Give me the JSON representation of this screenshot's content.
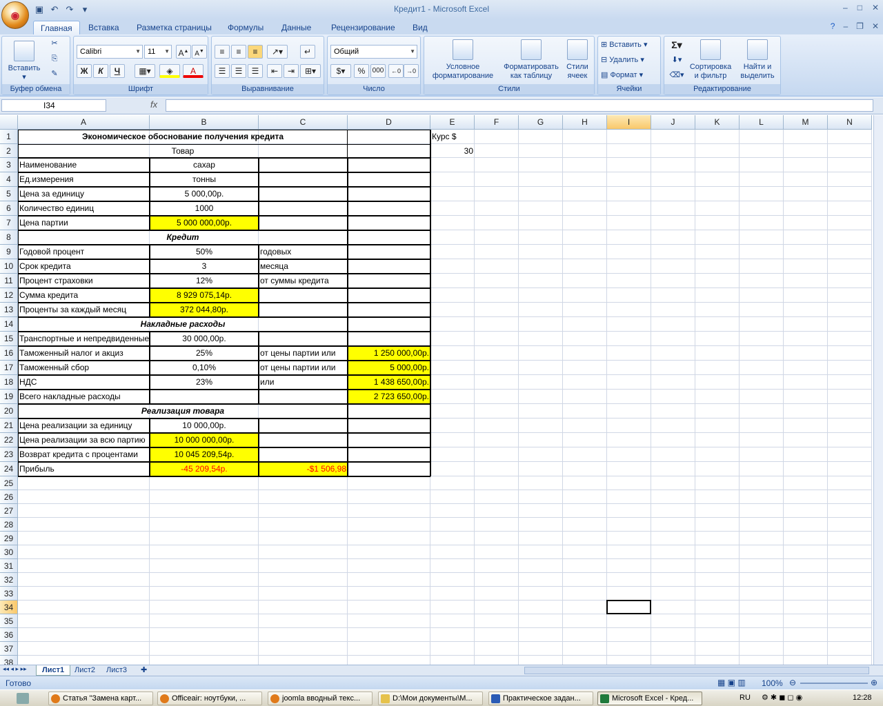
{
  "window": {
    "title": "Кредит1 - Microsoft Excel"
  },
  "ribbon_tabs": [
    "Главная",
    "Вставка",
    "Разметка страницы",
    "Формулы",
    "Данные",
    "Рецензирование",
    "Вид"
  ],
  "ribbon": {
    "paste": "Вставить",
    "font_name": "Calibri",
    "font_size": "11",
    "number_format": "Общий",
    "cond_fmt": "Условное форматирование",
    "fmt_table": "Форматировать как таблицу",
    "cell_styles": "Стили ячеек",
    "insert": "Вставить",
    "delete": "Удалить",
    "format": "Формат",
    "sort_filter": "Сортировка и фильтр",
    "find_select": "Найти и выделить",
    "bold": "Ж",
    "italic": "К",
    "underline": "Ч",
    "percent": "%",
    "thousands": "000",
    "groups": {
      "clipboard": "Буфер обмена",
      "font": "Шрифт",
      "align": "Выравнивание",
      "number": "Число",
      "styles": "Стили",
      "cells": "Ячейки",
      "editing": "Редактирование"
    }
  },
  "formula_bar": {
    "name_box": "I34",
    "fx": "fx",
    "content": ""
  },
  "columns": [
    "A",
    "B",
    "C",
    "D",
    "E",
    "F",
    "G",
    "H",
    "I",
    "J",
    "K",
    "L",
    "M",
    "N"
  ],
  "rows": [
    "1",
    "2",
    "3",
    "4",
    "5",
    "6",
    "7",
    "8",
    "9",
    "10",
    "11",
    "12",
    "13",
    "14",
    "15",
    "16",
    "17",
    "18",
    "19",
    "20",
    "21",
    "22",
    "23",
    "24",
    "25",
    "26",
    "27",
    "28",
    "29",
    "30",
    "31",
    "32",
    "33",
    "34",
    "35",
    "36",
    "37",
    "38"
  ],
  "cells": {
    "A1": "Экономическое обоснование получения кредита",
    "E1": "Курс $",
    "B2": "Товар",
    "E2": "30",
    "A3": "Наименование",
    "B3": "сахар",
    "A4": "Ед.измерения",
    "B4": "тонны",
    "A5": "Цена за единицу",
    "B5": "5 000,00р.",
    "A6": "Количество единиц",
    "B6": "1000",
    "A7": "Цена партии",
    "B7": "5 000 000,00р.",
    "B8": "Кредит",
    "A9": "Годовой процент",
    "B9": "50%",
    "C9": "годовых",
    "A10": "Срок кредита",
    "B10": "3",
    "C10": "месяца",
    "A11": "Процент страховки",
    "B11": "12%",
    "C11": "от суммы кредита",
    "A12": "Сумма кредита",
    "B12": "8 929 075,14р.",
    "A13": "Проценты за каждый месяц",
    "B13": "372 044,80р.",
    "B14": "Накладные расходы",
    "A15": "Транспортные и непредвиденные",
    "B15": "30 000,00р.",
    "A16": "Таможенный налог и акциз",
    "B16": "25%",
    "C16": "от цены партии или",
    "D16": "1 250 000,00р.",
    "A17": "Таможенный сбор",
    "B17": "0,10%",
    "C17": "от цены партии или",
    "D17": "5 000,00р.",
    "A18": "НДС",
    "B18": "23%",
    "C18": "или",
    "D18": "1 438 650,00р.",
    "A19": "Всего накладные расходы",
    "D19": "2 723 650,00р.",
    "B20": "Реализация товара",
    "A21": "Цена реализации за единицу",
    "B21": "10 000,00р.",
    "A22": "Цена реализации за всю партию",
    "B22": "10 000 000,00р.",
    "A23": "Возврат кредита с процентами",
    "B23": "10 045 209,54р.",
    "A24": "Прибыль",
    "B24": "-45 209,54р.",
    "C24": "-$1 506,98"
  },
  "sheets": [
    "Лист1",
    "Лист2",
    "Лист3"
  ],
  "status": {
    "ready": "Готово",
    "zoom": "100%"
  },
  "taskbar": {
    "items": [
      "Статья \"Замена карт...",
      "Officeair: ноутбуки, ...",
      "joomla вводный текс...",
      "D:\\Мои документы\\М...",
      "Практическое задан...",
      "Microsoft Excel - Кред..."
    ],
    "lang": "RU",
    "clock": "12:28"
  },
  "colors": {
    "highlight": "#ffff00",
    "negative": "#ff0000",
    "selection": "#000000"
  }
}
